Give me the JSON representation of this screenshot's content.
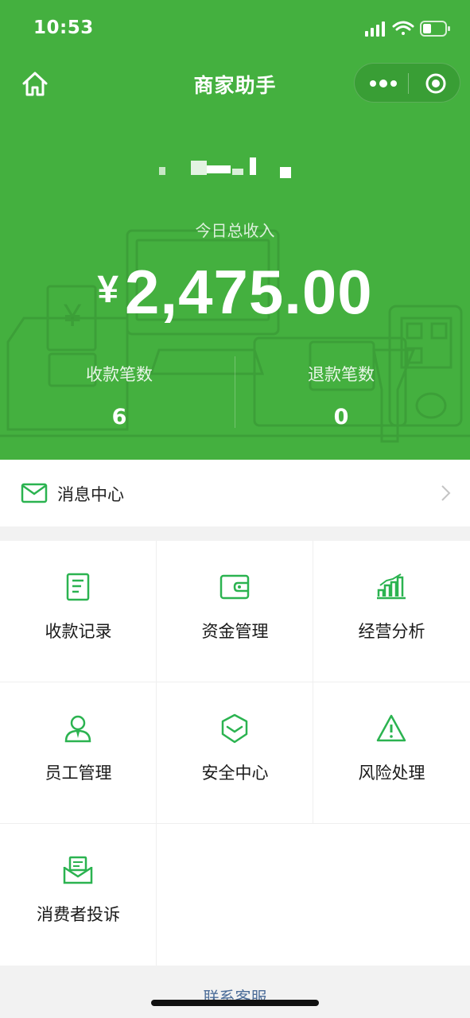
{
  "status_bar": {
    "time": "10:53"
  },
  "nav": {
    "title": "商家助手"
  },
  "summary": {
    "income_label": "今日总收入",
    "currency": "¥",
    "income_amount": "2,475.00",
    "payments_label": "收款笔数",
    "payments_count": "6",
    "refunds_label": "退款笔数",
    "refunds_count": "0"
  },
  "message_center": {
    "label": "消息中心"
  },
  "grid": {
    "items": [
      {
        "label": "收款记录",
        "icon": "receipt-icon"
      },
      {
        "label": "资金管理",
        "icon": "wallet-icon"
      },
      {
        "label": "经营分析",
        "icon": "bar-chart-icon"
      },
      {
        "label": "员工管理",
        "icon": "staff-icon"
      },
      {
        "label": "安全中心",
        "icon": "shield-icon"
      },
      {
        "label": "风险处理",
        "icon": "warning-icon"
      },
      {
        "label": "消费者投诉",
        "icon": "complaint-icon"
      }
    ]
  },
  "footer": {
    "contact_label": "联系客服"
  },
  "colors": {
    "brand_green": "#44b03f",
    "icon_green": "#2bb350",
    "link": "#4c6d99"
  }
}
